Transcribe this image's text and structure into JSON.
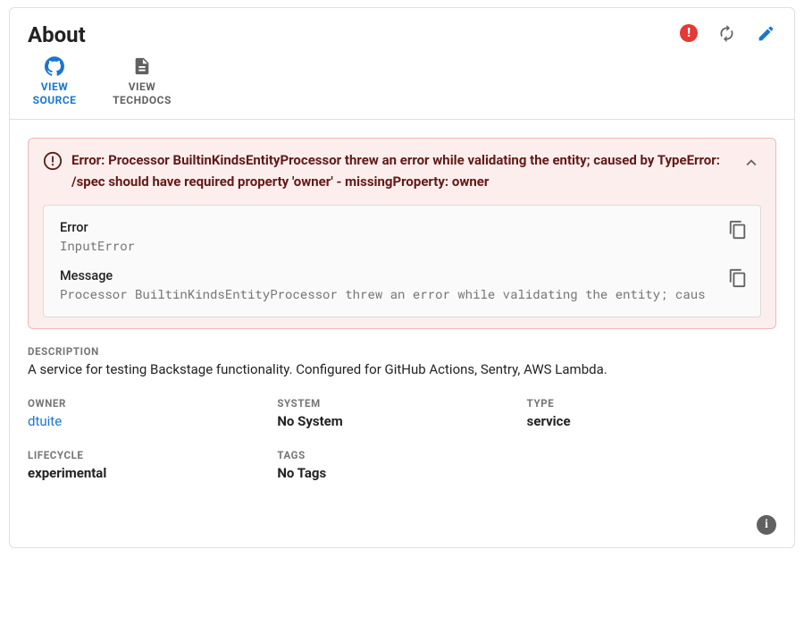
{
  "header": {
    "title": "About"
  },
  "toolbar": {
    "view_source": "VIEW SOURCE",
    "view_techdocs": "VIEW TECHDOCS"
  },
  "alert": {
    "title": "Error: Processor BuiltinKindsEntityProcessor threw an error while validating the entity; caused by TypeError: /spec should have required property 'owner' - missingProperty: owner",
    "error_label": "Error",
    "error_value": "InputError",
    "message_label": "Message",
    "message_value": "Processor BuiltinKindsEntityProcessor threw an error while validating the entity; caus"
  },
  "meta": {
    "description_label": "DESCRIPTION",
    "description_value": "A service for testing Backstage functionality. Configured for GitHub Actions, Sentry, AWS Lambda.",
    "owner_label": "OWNER",
    "owner_value": "dtuite",
    "system_label": "SYSTEM",
    "system_value": "No System",
    "type_label": "TYPE",
    "type_value": "service",
    "lifecycle_label": "LIFECYCLE",
    "lifecycle_value": "experimental",
    "tags_label": "TAGS",
    "tags_value": "No Tags"
  }
}
